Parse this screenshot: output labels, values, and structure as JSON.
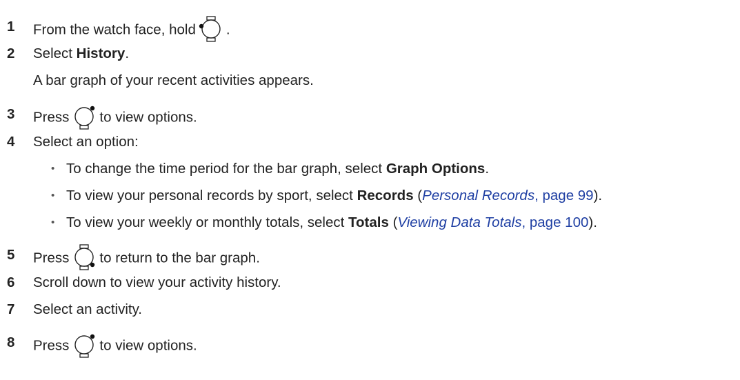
{
  "steps": [
    {
      "num": "1",
      "before": "From the watch face, hold",
      "icon": "watch-button-left-dot-icon",
      "after": "."
    },
    {
      "num": "2",
      "before": "Select ",
      "bold": "History",
      "after": "."
    },
    {
      "continuation": "A bar graph of your recent activities appears."
    },
    {
      "num": "3",
      "before": "Press",
      "icon": "watch-button-top-right-dot-icon",
      "after": "to view options."
    },
    {
      "num": "4",
      "text": "Select an option:"
    },
    {
      "num": "5",
      "before": "Press",
      "icon": "watch-button-bottom-right-dot-icon",
      "after": "to return to the bar graph."
    },
    {
      "num": "6",
      "text": "Scroll down to view your activity history."
    },
    {
      "num": "7",
      "text": "Select an activity."
    },
    {
      "num": "8",
      "before": "Press",
      "icon": "watch-button-top-right-dot-icon",
      "after": "to view options."
    }
  ],
  "options": [
    {
      "bullet": "•",
      "text": "To change the time period for the bar graph, select ",
      "bold": "Graph Options",
      "after": "."
    },
    {
      "bullet": "•",
      "text": "To view your personal records by sport, select ",
      "bold": "Records",
      "paren_open": " (",
      "link_title": "Personal Records",
      "link_page": ", page 99",
      "paren_close": ")."
    },
    {
      "bullet": "•",
      "text": "To view your weekly or monthly totals, select ",
      "bold": "Totals",
      "paren_open": " (",
      "link_title": "Viewing Data Totals",
      "link_page": ", page 100",
      "paren_close": ")."
    }
  ],
  "colors": {
    "text": "#222222",
    "link": "#1f3fa3"
  }
}
